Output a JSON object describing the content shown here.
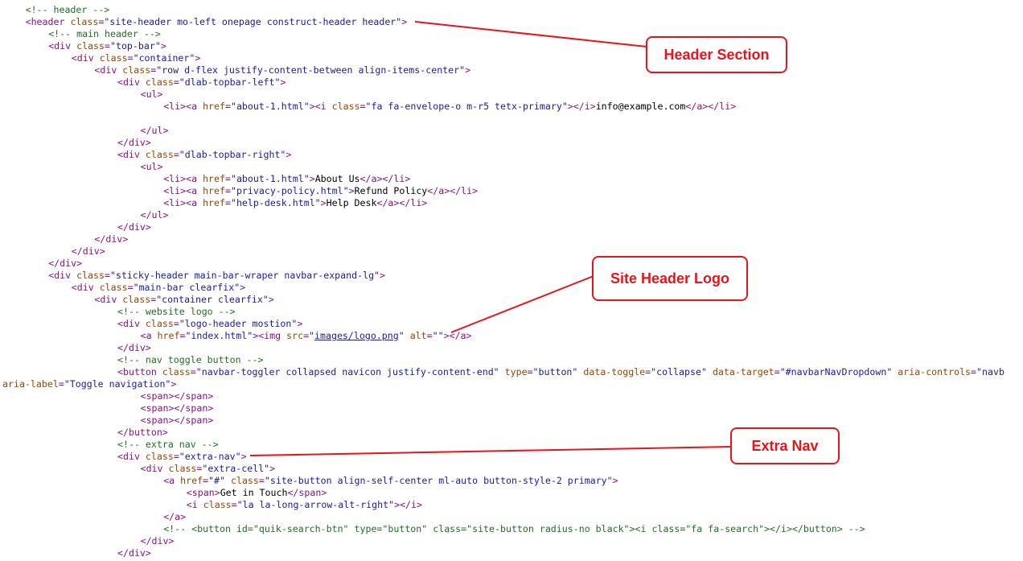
{
  "code_lines": [
    {
      "indent": 1,
      "tokens": [
        [
          "c",
          "<!-- header -->"
        ]
      ]
    },
    {
      "indent": 1,
      "tokens": [
        [
          "t",
          "<header "
        ],
        [
          "a",
          "class"
        ],
        [
          "t",
          "="
        ],
        [
          "v",
          "\"site-header mo-left onepage construct-header header\""
        ],
        [
          "t",
          ">"
        ]
      ]
    },
    {
      "indent": 2,
      "tokens": [
        [
          "c",
          "<!-- main header -->"
        ]
      ]
    },
    {
      "indent": 2,
      "tokens": [
        [
          "t",
          "<div "
        ],
        [
          "a",
          "class"
        ],
        [
          "t",
          "="
        ],
        [
          "v",
          "\"top-bar\""
        ],
        [
          "t",
          ">"
        ]
      ]
    },
    {
      "indent": 3,
      "tokens": [
        [
          "t",
          "<div "
        ],
        [
          "a",
          "class"
        ],
        [
          "t",
          "="
        ],
        [
          "v",
          "\"container\""
        ],
        [
          "t",
          ">"
        ]
      ]
    },
    {
      "indent": 4,
      "tokens": [
        [
          "t",
          "<div "
        ],
        [
          "a",
          "class"
        ],
        [
          "t",
          "="
        ],
        [
          "v",
          "\"row d-flex justify-content-between align-items-center\""
        ],
        [
          "t",
          ">"
        ]
      ]
    },
    {
      "indent": 5,
      "tokens": [
        [
          "t",
          "<div "
        ],
        [
          "a",
          "class"
        ],
        [
          "t",
          "="
        ],
        [
          "v",
          "\"dlab-topbar-left\""
        ],
        [
          "t",
          ">"
        ]
      ]
    },
    {
      "indent": 6,
      "tokens": [
        [
          "t",
          "<ul>"
        ]
      ]
    },
    {
      "indent": 7,
      "tokens": [
        [
          "t",
          "<li><a "
        ],
        [
          "a",
          "href"
        ],
        [
          "t",
          "="
        ],
        [
          "v",
          "\"about-1.html\""
        ],
        [
          "t",
          "><i "
        ],
        [
          "a",
          "class"
        ],
        [
          "t",
          "="
        ],
        [
          "v",
          "\"fa fa-envelope-o m-r5 tetx-primary\""
        ],
        [
          "t",
          "></i>"
        ],
        [
          "x",
          "info@example.com"
        ],
        [
          "t",
          "</a></li>"
        ]
      ]
    },
    {
      "indent": 0,
      "tokens": []
    },
    {
      "indent": 6,
      "tokens": [
        [
          "t",
          "</ul>"
        ]
      ]
    },
    {
      "indent": 5,
      "tokens": [
        [
          "t",
          "</div>"
        ]
      ]
    },
    {
      "indent": 5,
      "tokens": [
        [
          "t",
          "<div "
        ],
        [
          "a",
          "class"
        ],
        [
          "t",
          "="
        ],
        [
          "v",
          "\"dlab-topbar-right\""
        ],
        [
          "t",
          ">"
        ]
      ]
    },
    {
      "indent": 6,
      "tokens": [
        [
          "t",
          "<ul>"
        ]
      ]
    },
    {
      "indent": 7,
      "tokens": [
        [
          "t",
          "<li><a "
        ],
        [
          "a",
          "href"
        ],
        [
          "t",
          "="
        ],
        [
          "v",
          "\"about-1.html\""
        ],
        [
          "t",
          ">"
        ],
        [
          "x",
          "About Us"
        ],
        [
          "t",
          "</a></li>"
        ]
      ]
    },
    {
      "indent": 7,
      "tokens": [
        [
          "t",
          "<li><a "
        ],
        [
          "a",
          "href"
        ],
        [
          "t",
          "="
        ],
        [
          "v",
          "\"privacy-policy.html\""
        ],
        [
          "t",
          ">"
        ],
        [
          "x",
          "Refund Policy"
        ],
        [
          "t",
          "</a></li>"
        ]
      ]
    },
    {
      "indent": 7,
      "tokens": [
        [
          "t",
          "<li><a "
        ],
        [
          "a",
          "href"
        ],
        [
          "t",
          "="
        ],
        [
          "v",
          "\"help-desk.html\""
        ],
        [
          "t",
          ">"
        ],
        [
          "x",
          "Help Desk"
        ],
        [
          "t",
          "</a></li>"
        ]
      ]
    },
    {
      "indent": 6,
      "tokens": [
        [
          "t",
          "</ul>"
        ]
      ]
    },
    {
      "indent": 5,
      "tokens": [
        [
          "t",
          "</div>"
        ]
      ]
    },
    {
      "indent": 4,
      "tokens": [
        [
          "t",
          "</div>"
        ]
      ]
    },
    {
      "indent": 3,
      "tokens": [
        [
          "t",
          "</div>"
        ]
      ]
    },
    {
      "indent": 2,
      "tokens": [
        [
          "t",
          "</div>"
        ]
      ]
    },
    {
      "indent": 2,
      "tokens": [
        [
          "t",
          "<div "
        ],
        [
          "a",
          "class"
        ],
        [
          "t",
          "="
        ],
        [
          "v",
          "\"sticky-header main-bar-wraper navbar-expand-lg\""
        ],
        [
          "t",
          ">"
        ]
      ]
    },
    {
      "indent": 3,
      "tokens": [
        [
          "t",
          "<div "
        ],
        [
          "a",
          "class"
        ],
        [
          "t",
          "="
        ],
        [
          "v",
          "\"main-bar clearfix\""
        ],
        [
          "t",
          ">"
        ]
      ]
    },
    {
      "indent": 4,
      "tokens": [
        [
          "t",
          "<div "
        ],
        [
          "a",
          "class"
        ],
        [
          "t",
          "="
        ],
        [
          "v",
          "\"container clearfix\""
        ],
        [
          "t",
          ">"
        ]
      ]
    },
    {
      "indent": 5,
      "tokens": [
        [
          "c",
          "<!-- website logo -->"
        ]
      ]
    },
    {
      "indent": 5,
      "tokens": [
        [
          "t",
          "<div "
        ],
        [
          "a",
          "class"
        ],
        [
          "t",
          "="
        ],
        [
          "v",
          "\"logo-header mostion\""
        ],
        [
          "t",
          ">"
        ]
      ]
    },
    {
      "indent": 6,
      "tokens": [
        [
          "t",
          "<a "
        ],
        [
          "a",
          "href"
        ],
        [
          "t",
          "="
        ],
        [
          "v",
          "\"index.html\""
        ],
        [
          "t",
          "><img "
        ],
        [
          "a",
          "src"
        ],
        [
          "t",
          "="
        ],
        [
          "v",
          "\""
        ],
        [
          "u",
          "images/logo.png"
        ],
        [
          "v",
          "\""
        ],
        [
          "t",
          " "
        ],
        [
          "a",
          "alt"
        ],
        [
          "t",
          "="
        ],
        [
          "v",
          "\"\""
        ],
        [
          "t",
          "></a>"
        ]
      ]
    },
    {
      "indent": 5,
      "tokens": [
        [
          "t",
          "</div>"
        ]
      ]
    },
    {
      "indent": 5,
      "tokens": [
        [
          "c",
          "<!-- nav toggle button -->"
        ]
      ]
    },
    {
      "indent": 5,
      "tokens": [
        [
          "t",
          "<button "
        ],
        [
          "a",
          "class"
        ],
        [
          "t",
          "="
        ],
        [
          "v",
          "\"navbar-toggler collapsed navicon justify-content-end\""
        ],
        [
          "t",
          " "
        ],
        [
          "a",
          "type"
        ],
        [
          "t",
          "="
        ],
        [
          "v",
          "\"button\""
        ],
        [
          "t",
          " "
        ],
        [
          "a",
          "data-toggle"
        ],
        [
          "t",
          "="
        ],
        [
          "v",
          "\"collapse\""
        ],
        [
          "t",
          " "
        ],
        [
          "a",
          "data-target"
        ],
        [
          "t",
          "="
        ],
        [
          "v",
          "\"#navbarNavDropdown\""
        ],
        [
          "t",
          " "
        ],
        [
          "a",
          "aria-controls"
        ],
        [
          "t",
          "="
        ],
        [
          "v",
          "\"navb"
        ]
      ]
    },
    {
      "indent": 0,
      "tokens": [
        [
          "a",
          "aria-label"
        ],
        [
          "t",
          "="
        ],
        [
          "v",
          "\"Toggle navigation\""
        ],
        [
          "t",
          ">"
        ]
      ]
    },
    {
      "indent": 6,
      "tokens": [
        [
          "t",
          "<span></span>"
        ]
      ]
    },
    {
      "indent": 6,
      "tokens": [
        [
          "t",
          "<span></span>"
        ]
      ]
    },
    {
      "indent": 6,
      "tokens": [
        [
          "t",
          "<span></span>"
        ]
      ]
    },
    {
      "indent": 5,
      "tokens": [
        [
          "t",
          "</button>"
        ]
      ]
    },
    {
      "indent": 5,
      "tokens": [
        [
          "c",
          "<!-- extra nav -->"
        ]
      ]
    },
    {
      "indent": 5,
      "tokens": [
        [
          "t",
          "<div "
        ],
        [
          "a",
          "class"
        ],
        [
          "t",
          "="
        ],
        [
          "v",
          "\"extra-nav\""
        ],
        [
          "t",
          ">"
        ]
      ]
    },
    {
      "indent": 6,
      "tokens": [
        [
          "t",
          "<div "
        ],
        [
          "a",
          "class"
        ],
        [
          "t",
          "="
        ],
        [
          "v",
          "\"extra-cell\""
        ],
        [
          "t",
          ">"
        ]
      ]
    },
    {
      "indent": 7,
      "tokens": [
        [
          "t",
          "<a "
        ],
        [
          "a",
          "href"
        ],
        [
          "t",
          "="
        ],
        [
          "v",
          "\"#\""
        ],
        [
          "t",
          " "
        ],
        [
          "a",
          "class"
        ],
        [
          "t",
          "="
        ],
        [
          "v",
          "\"site-button align-self-center ml-auto button-style-2 primary\""
        ],
        [
          "t",
          ">"
        ]
      ]
    },
    {
      "indent": 8,
      "tokens": [
        [
          "t",
          "<span>"
        ],
        [
          "x",
          "Get in Touch"
        ],
        [
          "t",
          "</span>"
        ]
      ]
    },
    {
      "indent": 8,
      "tokens": [
        [
          "t",
          "<i "
        ],
        [
          "a",
          "class"
        ],
        [
          "t",
          "="
        ],
        [
          "v",
          "\"la la-long-arrow-alt-right\""
        ],
        [
          "t",
          "></i>"
        ]
      ]
    },
    {
      "indent": 7,
      "tokens": [
        [
          "t",
          "</a>"
        ]
      ]
    },
    {
      "indent": 7,
      "tokens": [
        [
          "c",
          "<!-- <button id=\"quik-search-btn\" type=\"button\" class=\"site-button radius-no black\"><i class=\"fa fa-search\"></i></button> -->"
        ]
      ]
    },
    {
      "indent": 6,
      "tokens": [
        [
          "t",
          "</div>"
        ]
      ]
    },
    {
      "indent": 5,
      "tokens": [
        [
          "t",
          "</div>"
        ]
      ]
    }
  ],
  "callouts": {
    "header_section": "Header Section",
    "site_header_logo": "Site Header Logo",
    "extra_nav": "Extra Nav"
  },
  "colors": {
    "callout": "#e8141c",
    "tag": "#881280",
    "attribute": "#994500",
    "value": "#1a1aa6",
    "comment": "#236e25"
  }
}
